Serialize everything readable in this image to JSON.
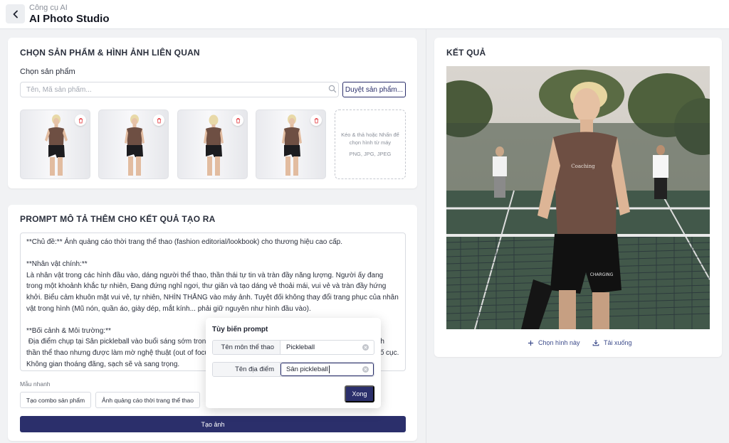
{
  "header": {
    "breadcrumb": "Công cụ AI",
    "title": "AI Photo Studio"
  },
  "products_card": {
    "title": "CHỌN SẢN PHẨM & HÌNH ẢNH LIÊN QUAN",
    "select_label": "Chọn sản phẩm",
    "search_placeholder": "Tên, Mã sản phẩm...",
    "browse_label": "Duyệt sản phẩm...",
    "dropzone_text": "Kéo & thả hoặc Nhấn để chọn hình từ máy",
    "dropzone_formats": "PNG, JPG, JPEG"
  },
  "prompt_card": {
    "title": "PROMPT MÔ TẢ THÊM CHO KẾT QUẢ TẠO RA",
    "lines": [
      "**Chủ đề:** Ảnh quảng cáo thời trang thể thao (fashion editorial/lookbook) cho thương hiệu cao cấp.",
      "",
      "**Nhân vật chính:**",
      "Là nhân vật trong các hình đầu vào, dáng người thể thao, thần thái tự tin và tràn đầy năng lượng. Người ấy đang trong một khoảnh khắc tự nhiên, Đang đứng nghỉ ngơi, thư giãn và tạo dáng vẻ thoải mái, vui vẻ và tràn đầy hứng khởi. Biểu cảm khuôn mặt vui vẻ, tự nhiên, NHÌN THẲNG vào máy ảnh. Tuyệt đối không thay đổi trang phục của nhân vật trong hình (Mũ nón, quần áo, giày dép, mắt kính... phải giữ nguyên như hình đầu vào).",
      "",
      "**Bối cảnh & Môi trường:**",
      " Địa điểm chụp tại Sân pickleball vào buổi sáng sớm trong khung cảnh thiên nhiên xanh mát. Hậu cảnh mang tinh thần thể thao nhưng được làm mờ nghệ thuật (out of focus / bokeh) để làm nổi bật nhân vật chính ở trung tâm bố cục. Không gian thoáng đãng, sạch sẽ và sang trọng."
    ],
    "quick_label": "Mẫu nhanh",
    "chip_1": "Tạo combo sản phẩm",
    "chip_2": "Ảnh quảng cáo thời trang thể thao",
    "generate_label": "Tạo ảnh"
  },
  "popover": {
    "title": "Tùy biến prompt",
    "sport_key": "Tên môn thể thao",
    "sport_value": "Pickleball",
    "place_key": "Tên địa điểm",
    "place_value": "Sân pickleball",
    "done_label": "Xong"
  },
  "result_card": {
    "title": "KẾT QUẢ",
    "shirt_text": "Coaching",
    "choose_label": "Chọn hình này",
    "download_label": "Tải xuống"
  },
  "colors": {
    "primary": "#2b2f6b",
    "shirt": "#6e4f43",
    "danger": "#e5484d"
  }
}
